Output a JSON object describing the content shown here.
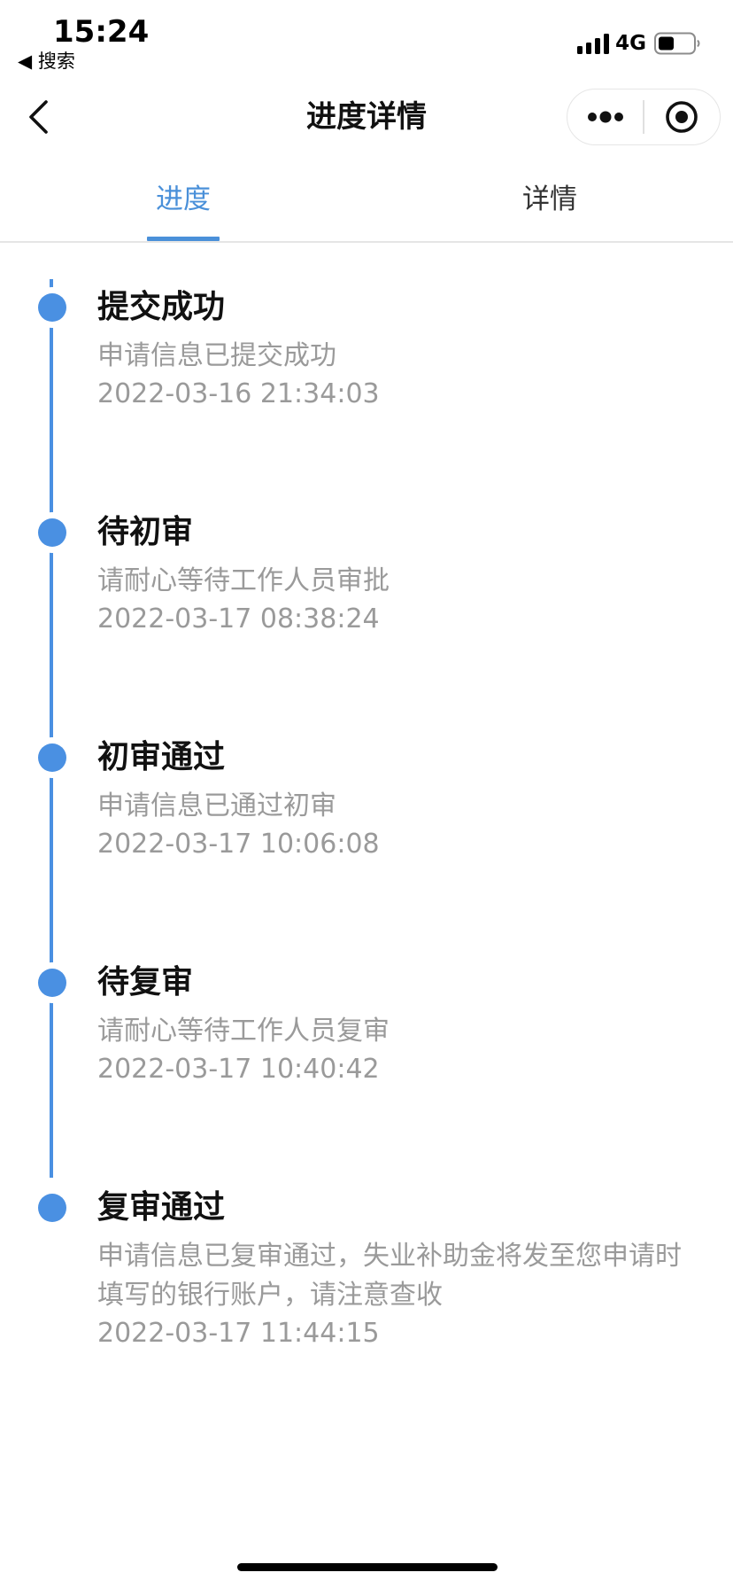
{
  "status_bar": {
    "time": "15:24",
    "back_app": "◀ 搜索",
    "network": "4G"
  },
  "nav": {
    "title": "进度详情"
  },
  "tabs": [
    {
      "label": "进度",
      "active": true
    },
    {
      "label": "详情",
      "active": false
    }
  ],
  "colors": {
    "accent": "#4a90e2",
    "tab_active": "#4a90d9",
    "secondary_text": "#9a9a9a"
  },
  "timeline": [
    {
      "title": "提交成功",
      "desc": "申请信息已提交成功",
      "time": "2022-03-16 21:34:03"
    },
    {
      "title": "待初审",
      "desc": "请耐心等待工作人员审批",
      "time": "2022-03-17 08:38:24"
    },
    {
      "title": "初审通过",
      "desc": "申请信息已通过初审",
      "time": "2022-03-17 10:06:08"
    },
    {
      "title": "待复审",
      "desc": "请耐心等待工作人员复审",
      "time": "2022-03-17 10:40:42"
    },
    {
      "title": "复审通过",
      "desc": "申请信息已复审通过，失业补助金将发至您申请时填写的银行账户，请注意查收",
      "time": "2022-03-17 11:44:15"
    }
  ]
}
